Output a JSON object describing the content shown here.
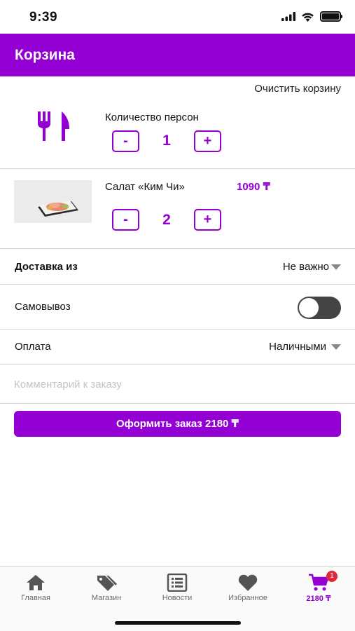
{
  "status_bar": {
    "time": "9:39"
  },
  "header": {
    "title": "Корзина"
  },
  "cart": {
    "clear_label": "Очистить корзину",
    "persons": {
      "label": "Количество персон",
      "minus": "-",
      "value": "1",
      "plus": "+"
    },
    "items": [
      {
        "name": "Салат «Ким Чи»",
        "price": "1090 ₸",
        "minus": "-",
        "quantity": "2",
        "plus": "+"
      }
    ]
  },
  "delivery": {
    "label": "Доставка из",
    "value": "Не важно"
  },
  "pickup": {
    "label": "Самовывоз",
    "enabled": false
  },
  "payment": {
    "label": "Оплата",
    "value": "Наличными"
  },
  "comment": {
    "placeholder": "Комментарий к заказу",
    "value": ""
  },
  "checkout": {
    "label": "Оформить заказ 2180 ₸"
  },
  "tab_bar": {
    "tabs": [
      {
        "label": "Главная",
        "icon": "home-icon"
      },
      {
        "label": "Магазин",
        "icon": "tag-icon"
      },
      {
        "label": "Новости",
        "icon": "news-icon"
      },
      {
        "label": "Избранное",
        "icon": "heart-icon"
      },
      {
        "label": "2180 ₸",
        "icon": "cart-icon",
        "active": true,
        "badge": "1"
      }
    ]
  },
  "colors": {
    "accent": "#9400d3",
    "badge": "#e0263c",
    "toggle_off": "#444444"
  }
}
